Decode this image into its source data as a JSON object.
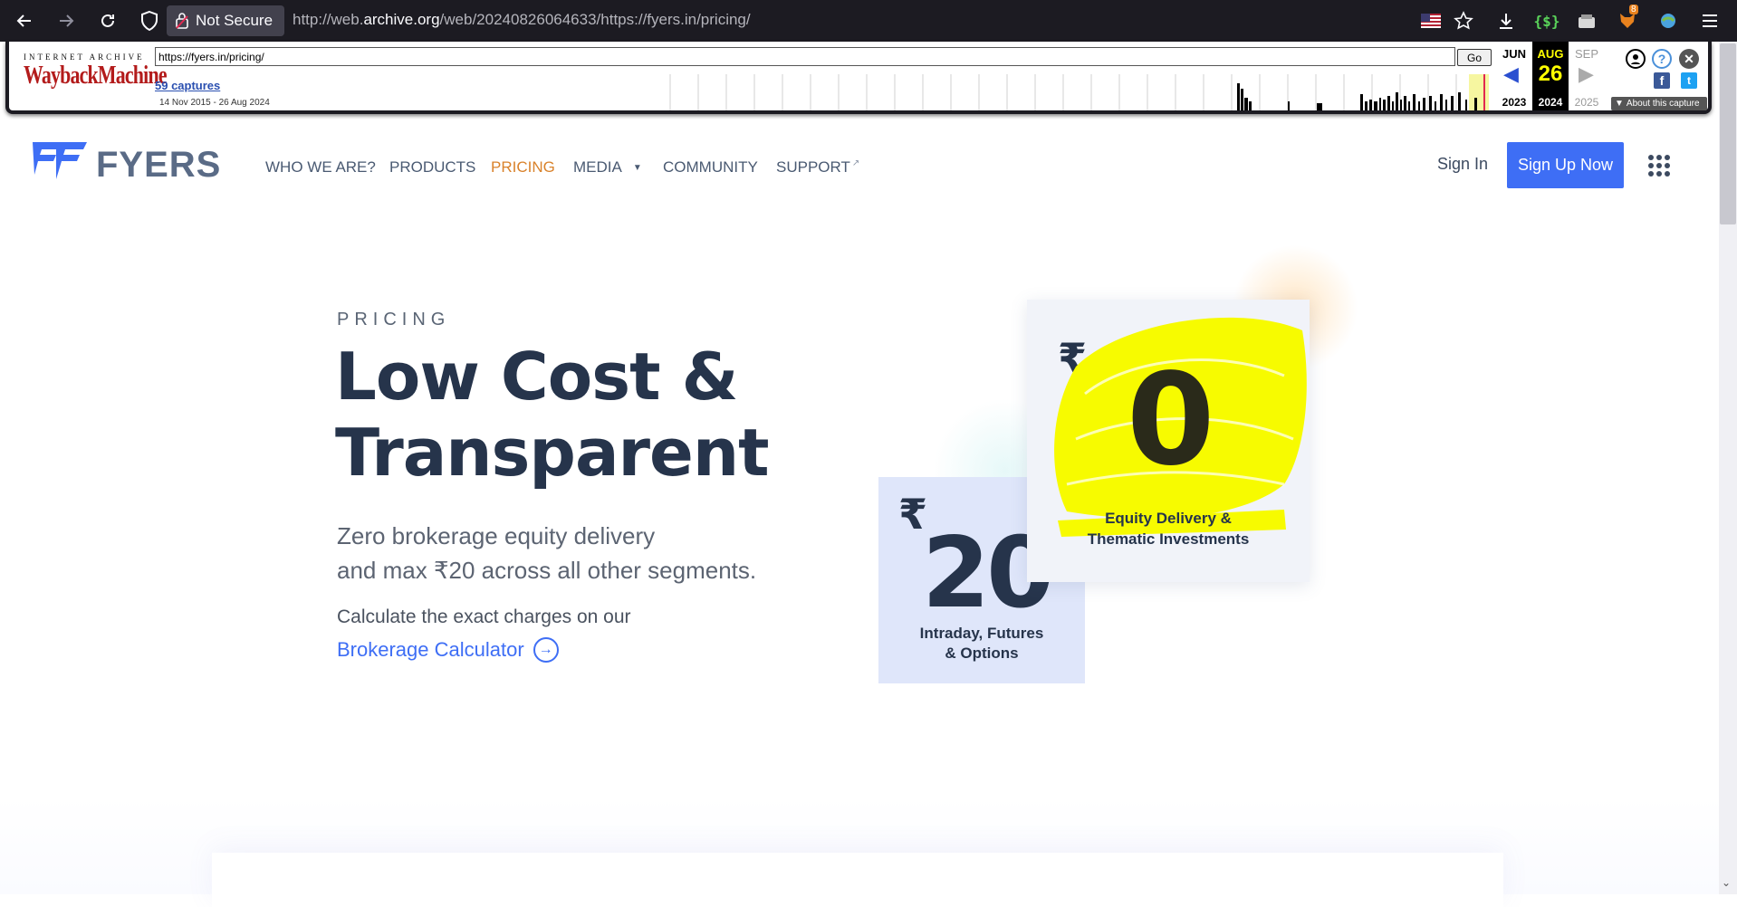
{
  "browser": {
    "security_label": "Not Secure",
    "url_prefix": "http://web.",
    "url_host": "archive.org",
    "url_path": "/web/20240826064633/https://fyers.in/pricing/",
    "extension_badge": "8"
  },
  "wayback": {
    "logo_top": "INTERNET ARCHIVE",
    "logo_main": "WaybackMachine",
    "url_value": "https://fyers.in/pricing/",
    "go_label": "Go",
    "captures_label": "59 captures",
    "date_range": "14 Nov 2015 - 26 Aug 2024",
    "prev_month": "JUN",
    "cur_month": "AUG",
    "next_month": "SEP",
    "cur_day": "26",
    "prev_year": "2023",
    "cur_year": "2024",
    "next_year": "2025",
    "about_label": "About this capture",
    "help_icon": "?",
    "facebook_icon": "f",
    "twitter_icon": "t"
  },
  "header": {
    "logo_text": "FYERS",
    "nav": [
      {
        "label": "WHO WE ARE?"
      },
      {
        "label": "PRODUCTS"
      },
      {
        "label": "PRICING"
      },
      {
        "label": "MEDIA"
      },
      {
        "label": "COMMUNITY"
      },
      {
        "label": "SUPPORT"
      }
    ],
    "sign_in": "Sign In",
    "sign_up": "Sign Up Now"
  },
  "hero": {
    "eyebrow": "PRICING",
    "title_line1": "Low Cost &",
    "title_line2": "Transparent",
    "sub_line1": "Zero brokerage equity delivery",
    "sub_line2": "and max ₹20 across all other segments.",
    "calc_text": "Calculate the exact charges on our",
    "calc_link": "Brokerage Calculator"
  },
  "cards": {
    "intraday": {
      "symbol": "₹",
      "value": "20",
      "caption_line1": "Intraday, Futures",
      "caption_line2": "& Options"
    },
    "delivery": {
      "symbol": "₹",
      "value": "0",
      "caption_line1": "Equity Delivery &",
      "caption_line2": "Thematic Investments"
    }
  },
  "colors": {
    "brand_blue": "#3e6ef5",
    "active_nav": "#d9822b",
    "heading": "#26344b",
    "scribble": "#f7fb00"
  }
}
